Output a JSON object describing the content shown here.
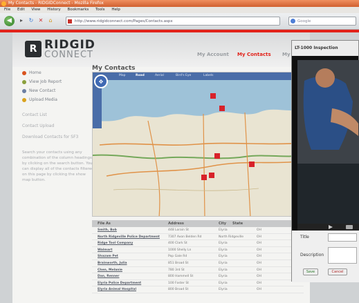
{
  "browser": {
    "title": "My Contacts - RIDGIDConnect - Mozilla Firefox",
    "menu": [
      "File",
      "Edit",
      "View",
      "History",
      "Bookmarks",
      "Tools",
      "Help"
    ],
    "url": "http://www.ridgidconnect.com/Pages/Contacts.aspx",
    "search_placeholder": "Google",
    "accent": "#e2231a"
  },
  "site": {
    "logo_top": "RIDGID",
    "logo_bottom": "CONNECT",
    "topnav": [
      {
        "label": "My Account",
        "active": false
      },
      {
        "label": "My Contacts",
        "active": true
      },
      {
        "label": "My",
        "active": false
      }
    ]
  },
  "sidebar": {
    "items": [
      {
        "label": "Home",
        "icon": "home-icon",
        "color": "#d9531e"
      },
      {
        "label": "View Job Report",
        "icon": "report-icon",
        "color": "#8aa03c"
      },
      {
        "label": "New Contact",
        "icon": "contact-icon",
        "color": "#6c7fa3"
      },
      {
        "label": "Upload Media",
        "icon": "upload-icon",
        "color": "#d9a21e"
      }
    ],
    "links": [
      "Contact List",
      "Contact Upload",
      "Download Contacts for SF3"
    ],
    "help": "Search your contacts using any combination of the column headings by clicking on the search button. You can display all of the contacts filtered on this page by clicking the show map button."
  },
  "main": {
    "title": "My Contacts",
    "map_tabs": [
      "Map",
      "Road",
      "Aerial",
      "Bird's Eye",
      "Labels"
    ],
    "table_headers": [
      "File As",
      "Address",
      "City",
      "State"
    ],
    "rows": [
      [
        "Smith, Bob",
        "448 Lorain St",
        "Elyria",
        "OH"
      ],
      [
        "North Ridgeville Police Department",
        "7307 Avon Belden Rd",
        "North Ridgeville",
        "OH"
      ],
      [
        "Ridge Tool Company",
        "400 Clark St",
        "Elyria",
        "OH"
      ],
      [
        "Walmart",
        "1000 Shelly Ln",
        "Elyria",
        "OH"
      ],
      [
        "Shazam Pet",
        "Pop Gale Rd",
        "Elyria",
        "OH"
      ],
      [
        "Brainworth, Julia",
        "851 Broad St",
        "Elyria",
        "OH"
      ],
      [
        "Chen, Melanie",
        "780 3rd St",
        "Elyria",
        "OH"
      ],
      [
        "Dan, Renner",
        "800 Hammell St",
        "Elyria",
        "OH"
      ],
      [
        "Elyria Police Department",
        "100 Foster St",
        "Elyria",
        "OH"
      ],
      [
        "Elyria Animal Hospital",
        "800 Broad St",
        "Elyria",
        "OH"
      ]
    ]
  },
  "video_panel": {
    "title": "LT-1000 Inspection",
    "title_label": "Title",
    "description_label": "Description",
    "save_label": "Save",
    "cancel_label": "Cancel"
  }
}
